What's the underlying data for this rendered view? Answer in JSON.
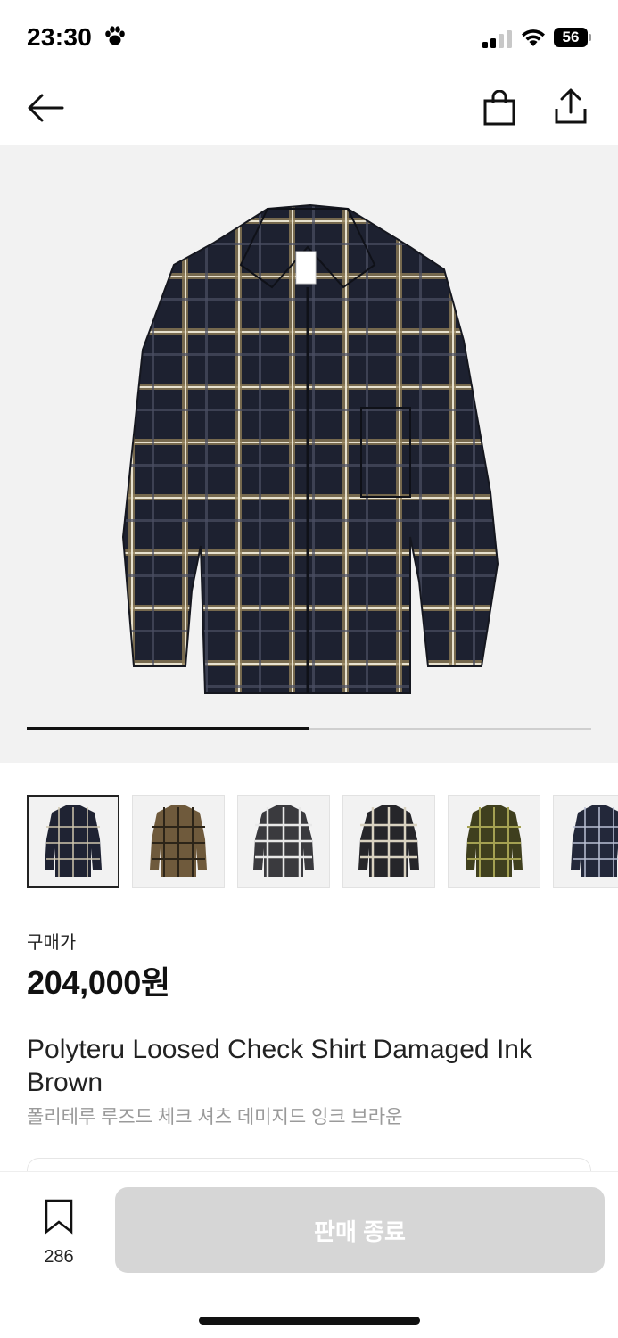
{
  "status_bar": {
    "time": "23:30",
    "battery": "56",
    "icons": [
      "paw-icon",
      "cellular-signal-icon",
      "wifi-icon",
      "battery-icon"
    ]
  },
  "nav": {
    "icons": [
      "back-arrow-icon",
      "shopping-bag-icon",
      "share-icon"
    ]
  },
  "gallery": {
    "progress_fraction": 0.5,
    "thumbnail_count": 6,
    "active_index": 0
  },
  "price": {
    "label": "구매가",
    "value": "204,000원"
  },
  "product": {
    "title_en": "Polyteru Loosed Check Shirt Damaged Ink Brown",
    "title_ko": "폴리테루 루즈드 체크 셔츠 데미지드 잉크 브라운"
  },
  "bottom_bar": {
    "bookmark_count": "286",
    "cta_label": "판매 종료"
  },
  "colors": {
    "cta_disabled": "#d6d6d6",
    "image_bg": "#f2f2f2",
    "text_primary": "#111111",
    "text_secondary": "#9a9a9a"
  }
}
